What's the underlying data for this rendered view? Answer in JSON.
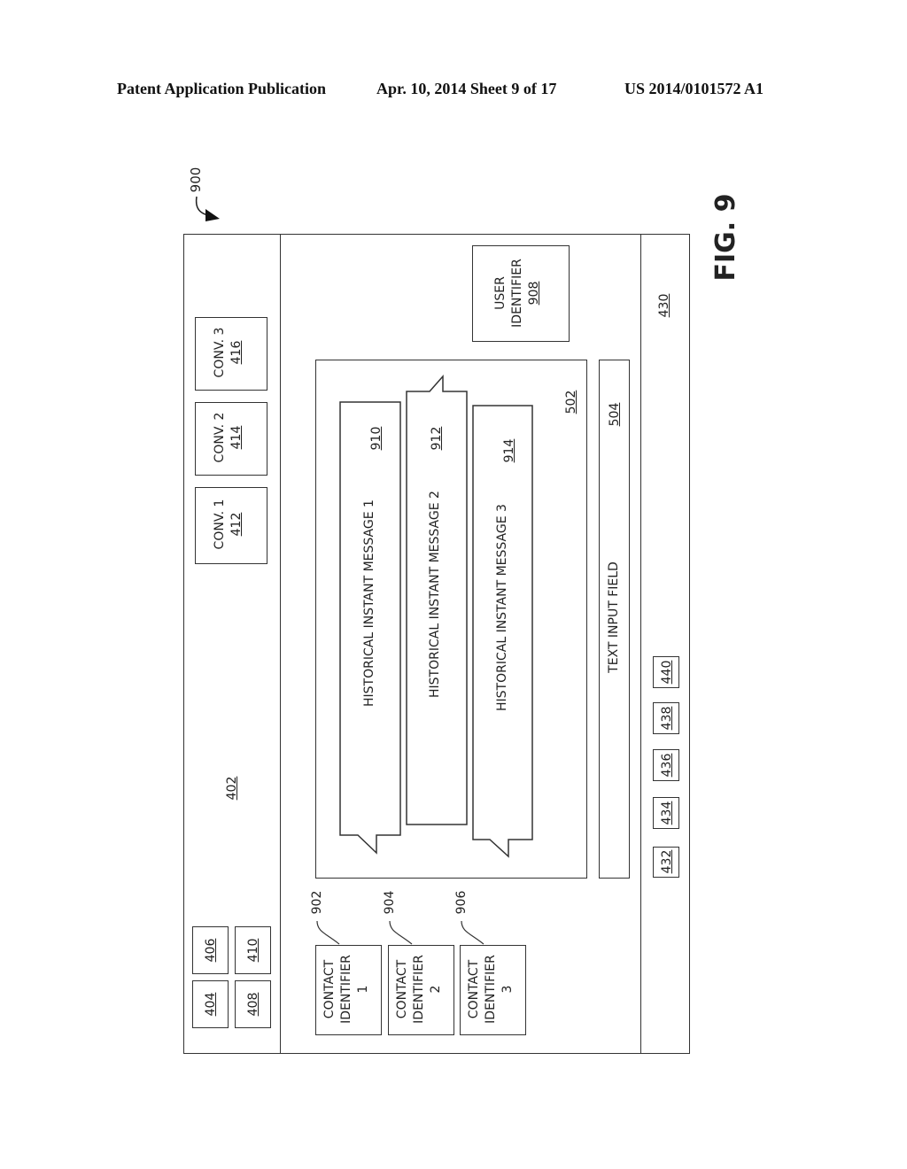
{
  "header": {
    "publication": "Patent Application Publication",
    "date_sheet": "Apr. 10, 2014  Sheet 9 of 17",
    "patent_number": "US 2014/0101572 A1"
  },
  "figure": {
    "label": "FIG. 9",
    "ref": "900"
  },
  "top_bar": {
    "ref": "402",
    "buttons": [
      "404",
      "406",
      "408",
      "410"
    ],
    "conversations": [
      {
        "label": "CONV. 1",
        "ref": "412"
      },
      {
        "label": "CONV. 2",
        "ref": "414"
      },
      {
        "label": "CONV. 3",
        "ref": "416"
      }
    ]
  },
  "contacts": [
    {
      "line1": "CONTACT",
      "line2": "IDENTIFIER",
      "line3": "1",
      "ref": "902"
    },
    {
      "line1": "CONTACT",
      "line2": "IDENTIFIER",
      "line3": "2",
      "ref": "904"
    },
    {
      "line1": "CONTACT",
      "line2": "IDENTIFIER",
      "line3": "3",
      "ref": "906"
    }
  ],
  "conversation_area": {
    "ref": "502",
    "messages": [
      {
        "text": "HISTORICAL INSTANT MESSAGE 1",
        "ref": "910"
      },
      {
        "text": "HISTORICAL INSTANT MESSAGE 2",
        "ref": "912"
      },
      {
        "text": "HISTORICAL INSTANT MESSAGE 3",
        "ref": "914"
      }
    ]
  },
  "text_input": {
    "label": "TEXT INPUT FIELD",
    "ref": "504"
  },
  "user_identifier": {
    "line1": "USER",
    "line2": "IDENTIFIER",
    "ref": "908"
  },
  "bottom_bar": {
    "ref": "430",
    "buttons": [
      "432",
      "434",
      "436",
      "438",
      "440"
    ]
  }
}
